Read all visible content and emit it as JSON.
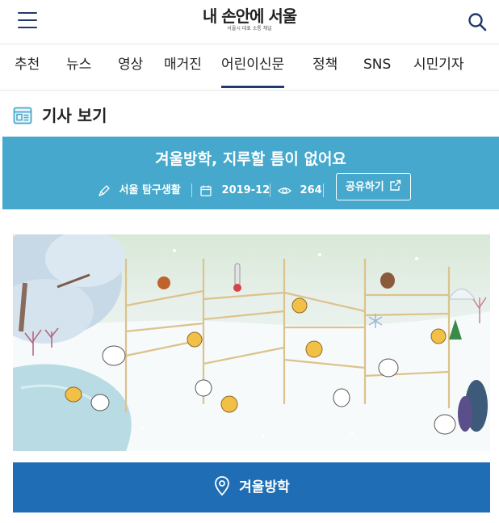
{
  "header": {
    "logo_title": "내 손안에 서울",
    "logo_subtitle": "서울시 대표 소통 채널",
    "menu_icon": "hamburger-menu-icon",
    "search_icon": "search-icon"
  },
  "nav": {
    "items": [
      {
        "label": "추천"
      },
      {
        "label": "뉴스"
      },
      {
        "label": "영상"
      },
      {
        "label": "매거진"
      },
      {
        "label": "어린이신문",
        "active": true
      },
      {
        "label": "정책"
      },
      {
        "label": "SNS"
      },
      {
        "label": "시민기자"
      }
    ]
  },
  "section": {
    "title": "기사 보기",
    "icon": "article-icon"
  },
  "article": {
    "title": "겨울방학, 지루할 틈이 없어요",
    "category": "서울 탐구생활",
    "date": "2019-12",
    "views": "264",
    "share_label": "공유하기",
    "illustration": "winter-vacation-illustration"
  },
  "tag": {
    "label": "겨울방학",
    "icon": "location-pin-icon"
  },
  "colors": {
    "primary_navy": "#1f3a6b",
    "banner_blue": "#45a8cc",
    "tag_blue": "#1f6db5"
  }
}
